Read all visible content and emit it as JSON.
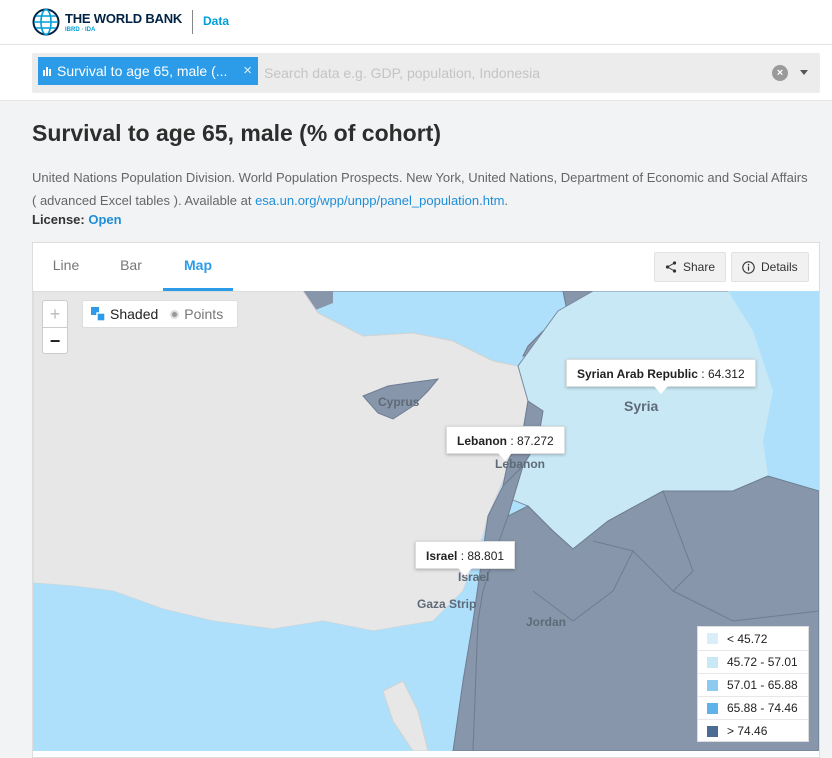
{
  "header": {
    "brand_title": "THE WORLD BANK",
    "brand_sub": "IBRD · IDA",
    "section_link": "Data"
  },
  "search": {
    "chip_label": "Survival to age 65, male (...",
    "placeholder": "Search data e.g. GDP, population, Indonesia",
    "value": ""
  },
  "indicator": {
    "title": "Survival to age 65, male (% of cohort)",
    "source_text": "United Nations Population Division. World Population Prospects. New York, United Nations, Department of Economic and Social Affairs ( advanced Excel tables ). Available at ",
    "source_link": "esa.un.org/wpp/unpp/panel_population.htm",
    "source_end": ".",
    "license_label": "License:",
    "license_value": "Open"
  },
  "chart_tabs": [
    {
      "label": "Line",
      "active": false
    },
    {
      "label": "Bar",
      "active": false
    },
    {
      "label": "Map",
      "active": true
    }
  ],
  "actions": {
    "share": "Share",
    "details": "Details"
  },
  "map": {
    "zoom_in": "+",
    "zoom_out": "−",
    "mode_shaded": "Shaded",
    "mode_points": "Points",
    "country_labels": {
      "cyprus": "Cyprus",
      "syria": "Syria",
      "lebanon": "Lebanon",
      "israel": "Israel",
      "gaza": "Gaza Strip",
      "jordan": "Jordan"
    },
    "tooltips": [
      {
        "country": "Syrian Arab Republic",
        "value": "64.312"
      },
      {
        "country": "Lebanon",
        "value": "87.272"
      },
      {
        "country": "Israel",
        "value": "88.801"
      }
    ],
    "colors": {
      "sea": "#aee0fb",
      "no_data_land": "#e7e7e7",
      "bin_top": "#8796aa",
      "bin_syria": "#c8e8f6"
    },
    "legend": [
      {
        "label": "< 45.72",
        "color": "#d9eef8"
      },
      {
        "label": "45.72 - 57.01",
        "color": "#c8e8f6"
      },
      {
        "label": "57.01 - 65.88",
        "color": "#8ccaf0"
      },
      {
        "label": "65.88 - 74.46",
        "color": "#5fb1ea"
      },
      {
        "label": "> 74.46",
        "color": "#4a6c92"
      }
    ]
  }
}
